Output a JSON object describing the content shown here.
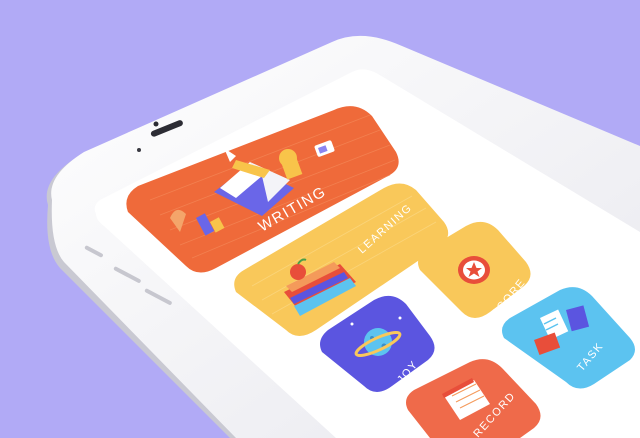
{
  "colors": {
    "background": "#b1aaf6",
    "phone_body": "#f6f6f8",
    "screen": "#ffffff",
    "writing_tile": "#ef6a3a",
    "learning_tile": "#f9c85a",
    "score_tile": "#f9c85a",
    "joy_tile": "#5b55e0",
    "task_tile": "#5cc3f0",
    "record_tile": "#ef6a4a"
  },
  "tiles": {
    "writing": {
      "label": "WRITING",
      "icon": "book-pencil-icon"
    },
    "learning": {
      "label": "LEARNING",
      "icon": "books-apple-icon"
    },
    "score": {
      "label": "SCORE",
      "icon": "star-badge-icon"
    },
    "joy": {
      "label": "JOY",
      "icon": "planet-icon"
    },
    "task": {
      "label": "TASK",
      "icon": "cards-icon"
    },
    "record": {
      "label": "RECORD",
      "icon": "notepad-icon"
    }
  }
}
